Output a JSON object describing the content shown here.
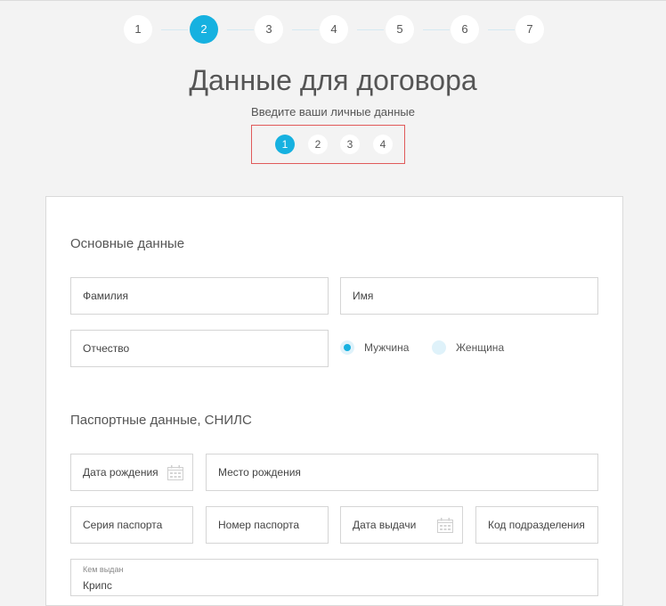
{
  "stepper": {
    "steps": [
      "1",
      "2",
      "3",
      "4",
      "5",
      "6",
      "7"
    ],
    "active_index": 1
  },
  "header": {
    "title": "Данные для договора",
    "subtitle": "Введите ваши личные данные"
  },
  "substeps": {
    "steps": [
      "1",
      "2",
      "3",
      "4"
    ],
    "active_index": 0
  },
  "form": {
    "basic_section_title": "Основные данные",
    "last_name_label": "Фамилия",
    "first_name_label": "Имя",
    "patronymic_label": "Отчество",
    "gender_male_label": "Мужчина",
    "gender_female_label": "Женщина",
    "gender_selected": "Мужчина",
    "passport_section_title": "Паспортные данные, СНИЛС",
    "birth_date_label": "Дата рождения",
    "birth_place_label": "Место рождения",
    "passport_series_label": "Серия паспорта",
    "passport_number_label": "Номер паспорта",
    "issue_date_label": "Дата выдачи",
    "division_code_label": "Код подразделения",
    "issued_by_label": "Кем выдан",
    "issued_by_value": "Крипс"
  },
  "colors": {
    "accent": "#16b1e0",
    "highlight_border": "#e05a5a"
  },
  "icons": {
    "calendar": "calendar-icon"
  }
}
